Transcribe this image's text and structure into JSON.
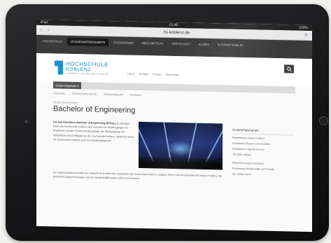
{
  "status": {
    "left": "iPad",
    "time": "15:48",
    "right": "100%"
  },
  "browser": {
    "back": "‹",
    "forward": "›",
    "url": "hs-koblenz.de",
    "reload": "↻"
  },
  "site_nav": {
    "items": [
      "Hochschule",
      "Studieninteressierte",
      "Studierende",
      "Beschäftigte",
      "Wirtschaft",
      "Alumni",
      "Internationales"
    ],
    "active_index": 1
  },
  "header": {
    "logo_line1": "HOCHSCHULE",
    "logo_line2": "KOBLENZ",
    "logo_line3": "UNIVERSITY OF APPLIED SCIENCES",
    "menu": [
      "Home",
      "Kontakt",
      "Presse",
      "Impressum"
    ],
    "search_icon": "search-icon"
  },
  "searchbar": {
    "button_label": "Studienangebote ▾"
  },
  "breadcrumbs": [
    "Startseite",
    "Studieninteressierte",
    "Studienangebot",
    "Bachelor"
  ],
  "main": {
    "kicker": "Studieninteressierte",
    "title": "Bachelor of Engineering",
    "paragraph1_lead": "Um den Abschluss Bachelor of Engineering (B.Eng.)",
    "paragraph1_rest": "zu erlangen, bietet die Hochschule Koblenz eine Vielzahl von Studiengängen an. Angeboten werden Präsenzstudiengänge, die Studiengänge mit Wahlpflicht und Zertifikaten an der Hochschule Koblenz. Weiterhin bietet die Hochschule Koblenz auch Fernstudiengänge an.",
    "paragraph2": "Ein ingenieurwissenschaftliches Studium ist an allen drei Standorten der Hochschule Koblenz möglich: Diese sind der RheinMoselCampus Koblenz, der RheinAhrCampus Remagen und der WesterWaldCampus Höhr-Grenzhausen."
  },
  "sidebar": {
    "heading": "Ansprechpersonen",
    "groups": [
      {
        "title": "RheinMoselCampus Koblenz",
        "lines": [
          "Fachbereich Bauen und Gestalten",
          "Fachbereich Ingenieurwesen",
          "Tel. 0261 9528-0"
        ]
      },
      {
        "title": "RheinAhrCampus Remagen",
        "lines": [
          "Fachbereich Mathematik und Technik",
          "Tel. 02642 932-0"
        ]
      }
    ]
  }
}
